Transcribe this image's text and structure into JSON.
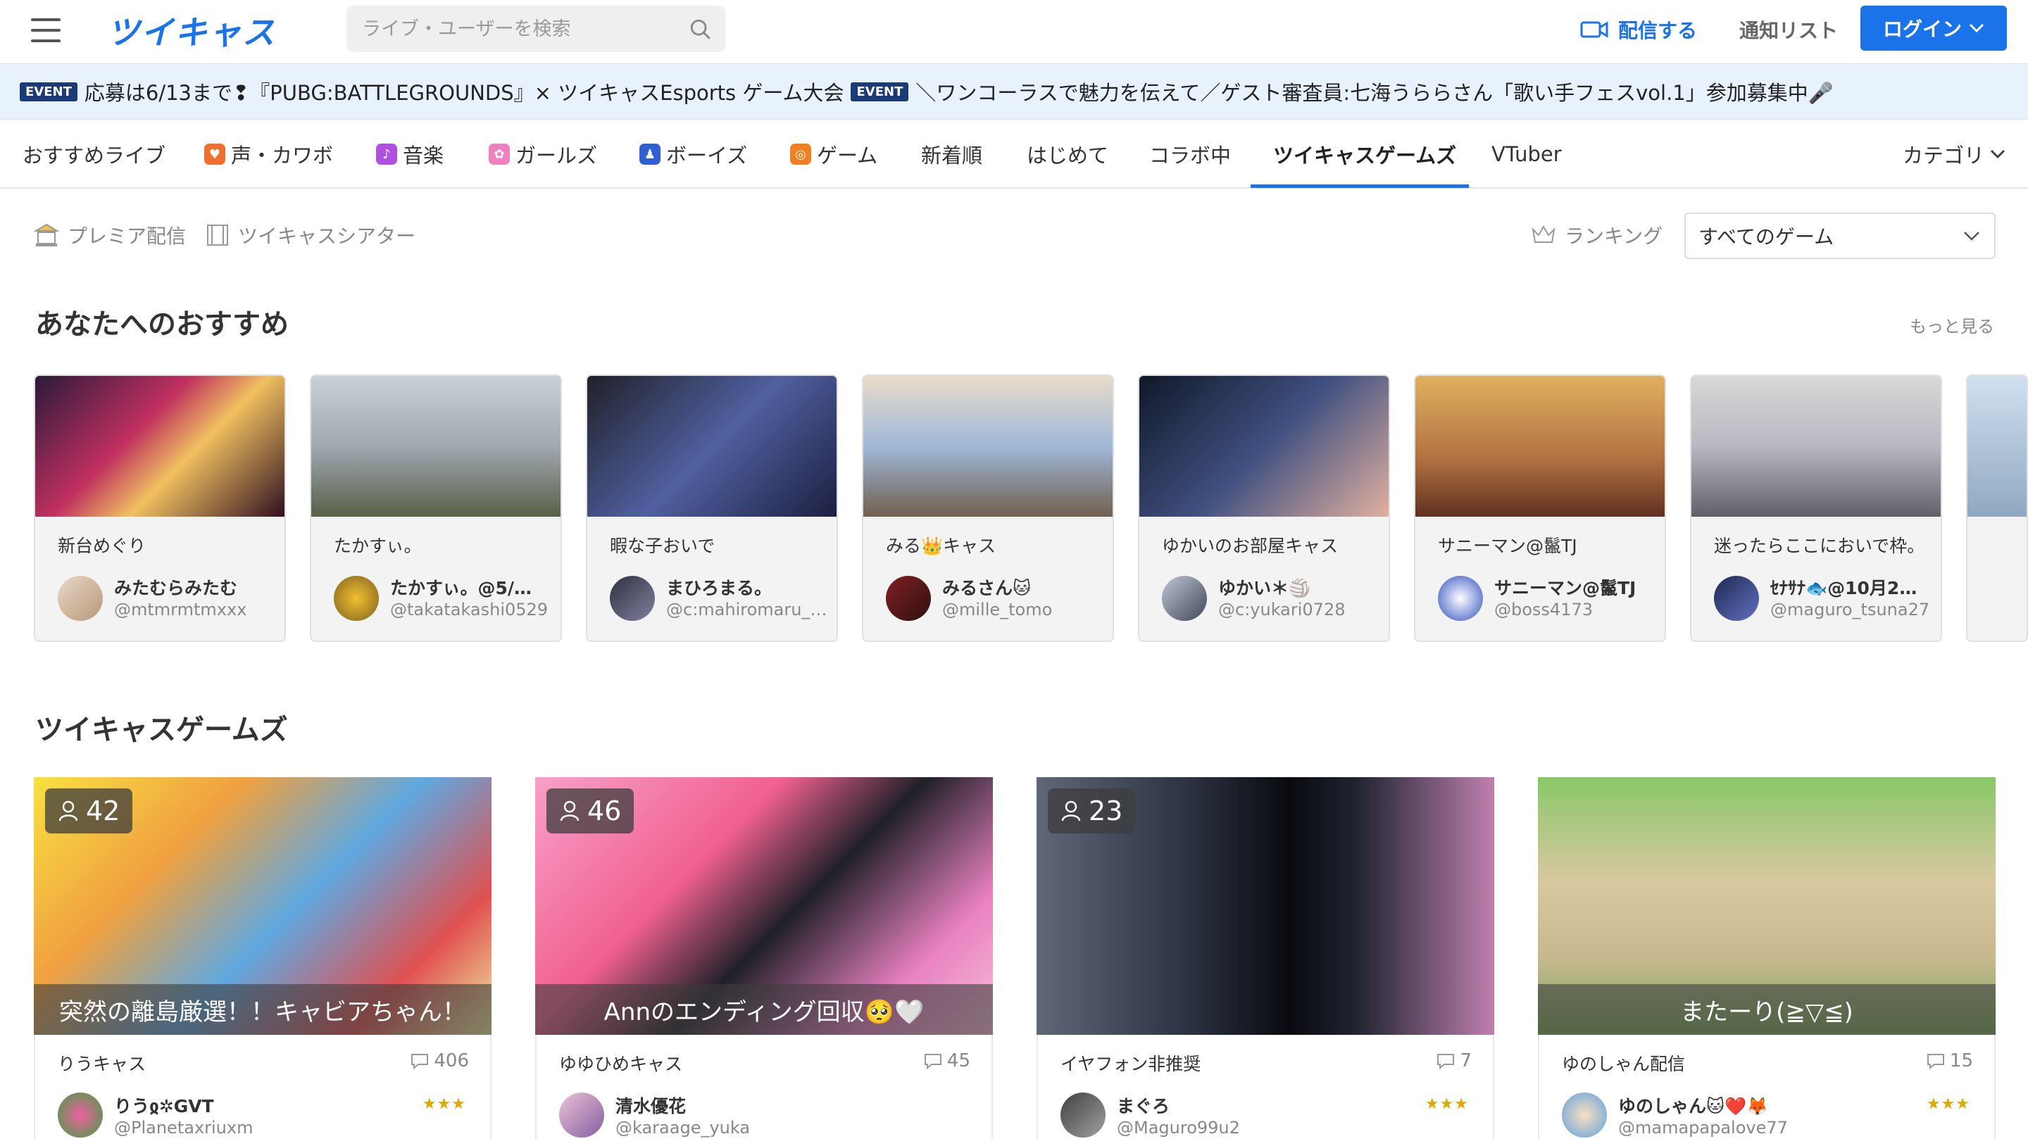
{
  "header": {
    "logo": "ツイキャス",
    "search_placeholder": "ライブ・ユーザーを検索",
    "broadcast_label": "配信する",
    "notify_label": "通知リスト",
    "login_label": "ログイン"
  },
  "banner": {
    "badge1": "EVENT",
    "text1": "応募は6/13まで❢『PUBG:BATTLEGROUNDS』× ツイキャスEsports ゲーム大会",
    "badge2": "EVENT",
    "text2": "＼ワンコーラスで魅力を伝えて／ゲスト審査員:七海うららさん「歌い手フェスvol.1」参加募集中🎤"
  },
  "tabs": {
    "items": [
      "おすすめライブ",
      "声・カワボ",
      "音楽",
      "ガールズ",
      "ボーイズ",
      "ゲーム",
      "新着順",
      "はじめて",
      "コラボ中",
      "ツイキャスゲームズ",
      "VTuber"
    ],
    "category": "カテゴリ",
    "active": "ツイキャスゲームズ"
  },
  "subrow": {
    "premier": "プレミア配信",
    "theater": "ツイキャスシアター",
    "ranking": "ランキング",
    "select_value": "すべてのゲーム"
  },
  "recommend": {
    "title": "あなたへのおすすめ",
    "more": "もっと見る",
    "cards": [
      {
        "title": "新台めぐり",
        "name": "みたむらみたむ",
        "id": "@mtmrmtmxxx"
      },
      {
        "title": "たかすぃ。",
        "name": "たかすぃ。@5/…",
        "id": "@takatakashi0529"
      },
      {
        "title": "暇な子おいで",
        "name": "まひろまる。",
        "id": "@c:mahiromaru_…"
      },
      {
        "title": "みる👑キャス",
        "name": "みるさん🐱",
        "id": "@mille_tomo"
      },
      {
        "title": "ゆかいのお部屋キャス",
        "name": "ゆかい＊🏐",
        "id": "@c:yukari0728"
      },
      {
        "title": "サニーマン@鬣TJ",
        "name": "サニーマン@鬣TJ",
        "id": "@boss4173"
      },
      {
        "title": "迷ったらここにおいで枠。",
        "name": "ｾﾅｻﾅ🐟@10月2…",
        "id": "@maguro_tsuna27"
      }
    ]
  },
  "games": {
    "title": "ツイキャスゲームズ",
    "cards": [
      {
        "viewers": "42",
        "caption": "突然の離島厳選！！キャビアちゃん！",
        "title": "りうキャス",
        "comments": "406",
        "name": "りうჲ✲GVT",
        "id": "@Planetaxriuxm",
        "stars": "★★★"
      },
      {
        "viewers": "46",
        "caption": "Annのエンディング回収🥺🤍",
        "title": "ゆゆひめキャス",
        "comments": "45",
        "name": "清水優花",
        "id": "@karaage_yuka",
        "stars": ""
      },
      {
        "viewers": "23",
        "caption": "",
        "title": "イヤフォン非推奨",
        "comments": "7",
        "name": "まぐろ",
        "id": "@Maguro99u2",
        "stars": "★★★"
      },
      {
        "viewers": "",
        "caption": "またーり(≧▽≦)",
        "title": "ゆのしゃん配信",
        "comments": "15",
        "name": "ゆのしゃん🐱❤️🦊",
        "id": "@mamapapalove77",
        "stars": "★★★"
      }
    ]
  },
  "colors": {
    "brand": "#1a73e8",
    "banner_bg": "#e8f2fd",
    "star": "#e0a800"
  }
}
